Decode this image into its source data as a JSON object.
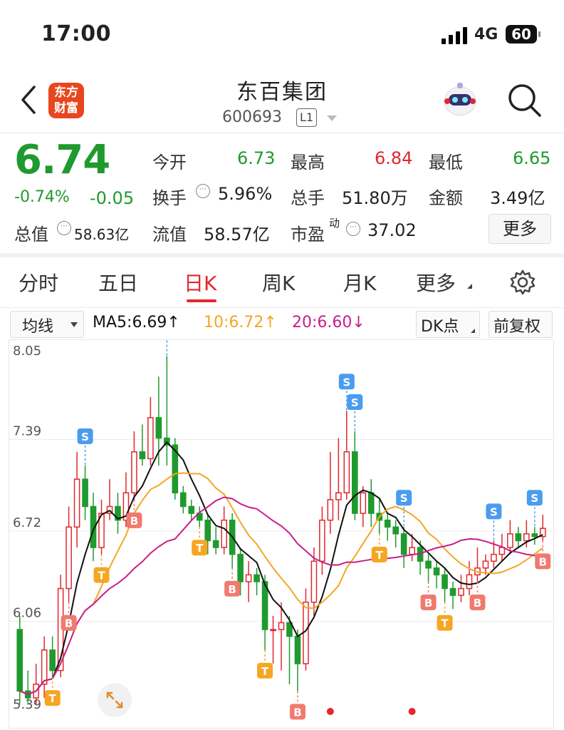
{
  "status_bar": {
    "time": "17:00",
    "network": "4G",
    "battery": "60"
  },
  "header": {
    "logo_text": "东方财富",
    "title": "东百集团",
    "code": "600693",
    "level": "L1"
  },
  "quote": {
    "price": "6.74",
    "change_pct": "-0.74%",
    "change": "-0.05",
    "open_label": "今开",
    "open": "6.73",
    "high_label": "最高",
    "high": "6.84",
    "low_label": "最低",
    "low": "6.65",
    "turnover_label": "换手",
    "turnover": "5.96%",
    "volume_label": "总手",
    "volume": "51.80万",
    "amount_label": "金额",
    "amount": "3.49亿",
    "mktcap_label": "总值",
    "mktcap": "58.63亿",
    "float_label": "流值",
    "float_cap": "58.57亿",
    "pe_label": "市盈",
    "pe_sup": "动",
    "pe": "37.02",
    "more_label": "更多"
  },
  "tabs": [
    {
      "label": "分时"
    },
    {
      "label": "五日"
    },
    {
      "label": "日K"
    },
    {
      "label": "周K"
    },
    {
      "label": "月K"
    },
    {
      "label": "更多"
    }
  ],
  "chart_controls": {
    "indicator": "均线",
    "ma5": "MA5:6.69↑",
    "ma10": "10:6.72↑",
    "ma20": "20:6.60↓",
    "dk": "DK点",
    "adjust": "前复权"
  },
  "colors": {
    "up": "#e0282e",
    "down": "#1f9a2e",
    "ma5": "#111111",
    "ma10": "#f5a623",
    "ma20": "#c81e8c",
    "accent": "#e0282e"
  },
  "chart_data": {
    "type": "candlestick",
    "y_axis_labels": [
      "8.05",
      "7.39",
      "6.72",
      "6.06",
      "5.39"
    ],
    "ylim": [
      5.39,
      8.05
    ],
    "markers": {
      "S": "S",
      "B": "B",
      "T": "T"
    },
    "candles": [
      [
        6.0,
        5.55,
        6.1,
        5.45
      ],
      [
        5.55,
        5.5,
        5.7,
        5.45
      ],
      [
        5.5,
        5.6,
        5.75,
        5.45
      ],
      [
        5.6,
        5.85,
        5.95,
        5.5
      ],
      [
        5.85,
        5.7,
        5.95,
        5.65
      ],
      [
        5.7,
        6.3,
        6.4,
        5.65
      ],
      [
        6.3,
        6.75,
        6.9,
        6.2
      ],
      [
        6.75,
        7.1,
        7.3,
        6.6
      ],
      [
        7.1,
        6.9,
        7.2,
        6.8
      ],
      [
        6.9,
        6.6,
        7.0,
        6.5
      ],
      [
        6.6,
        6.85,
        6.95,
        6.55
      ],
      [
        6.85,
        6.9,
        7.1,
        6.8
      ],
      [
        6.9,
        6.8,
        7.0,
        6.7
      ],
      [
        6.8,
        7.0,
        7.15,
        6.75
      ],
      [
        7.0,
        7.3,
        7.45,
        6.95
      ],
      [
        7.3,
        7.25,
        7.5,
        7.2
      ],
      [
        7.25,
        7.55,
        7.7,
        7.2
      ],
      [
        7.55,
        7.4,
        7.85,
        7.2
      ],
      [
        7.4,
        7.35,
        8.0,
        7.2
      ],
      [
        7.35,
        7.0,
        7.4,
        6.95
      ],
      [
        7.0,
        6.9,
        7.05,
        6.85
      ],
      [
        6.9,
        6.85,
        6.95,
        6.8
      ],
      [
        6.85,
        6.8,
        6.9,
        6.75
      ],
      [
        6.8,
        6.65,
        6.85,
        6.55
      ],
      [
        6.65,
        6.6,
        6.75,
        6.55
      ],
      [
        6.6,
        6.8,
        6.9,
        6.55
      ],
      [
        6.8,
        6.55,
        6.85,
        6.45
      ],
      [
        6.55,
        6.35,
        6.6,
        6.25
      ],
      [
        6.35,
        6.4,
        6.5,
        6.2
      ],
      [
        6.4,
        6.35,
        6.45,
        6.25
      ],
      [
        6.35,
        6.0,
        6.4,
        5.85
      ],
      [
        6.0,
        6.0,
        6.1,
        5.75
      ],
      [
        6.0,
        6.05,
        6.2,
        5.7
      ],
      [
        6.05,
        5.95,
        6.1,
        5.6
      ],
      [
        5.95,
        5.75,
        6.0,
        5.55
      ],
      [
        5.75,
        6.2,
        6.3,
        5.7
      ],
      [
        6.2,
        6.5,
        6.6,
        6.1
      ],
      [
        6.5,
        6.8,
        6.9,
        6.4
      ],
      [
        6.8,
        6.95,
        7.3,
        6.7
      ],
      [
        6.95,
        7.0,
        7.4,
        6.8
      ],
      [
        7.0,
        7.3,
        7.6,
        6.95
      ],
      [
        7.3,
        6.85,
        7.45,
        6.8
      ],
      [
        6.85,
        7.0,
        7.05,
        6.75
      ],
      [
        7.0,
        6.85,
        7.1,
        6.75
      ],
      [
        6.85,
        6.8,
        6.95,
        6.7
      ],
      [
        6.8,
        6.75,
        6.85,
        6.65
      ],
      [
        6.75,
        6.7,
        6.8,
        6.6
      ],
      [
        6.7,
        6.55,
        6.75,
        6.45
      ],
      [
        6.55,
        6.6,
        6.7,
        6.5
      ],
      [
        6.6,
        6.5,
        6.65,
        6.4
      ],
      [
        6.5,
        6.45,
        6.55,
        6.35
      ],
      [
        6.45,
        6.4,
        6.5,
        6.3
      ],
      [
        6.4,
        6.3,
        6.45,
        6.2
      ],
      [
        6.3,
        6.25,
        6.35,
        6.15
      ],
      [
        6.25,
        6.3,
        6.4,
        6.2
      ],
      [
        6.3,
        6.4,
        6.5,
        6.25
      ],
      [
        6.4,
        6.45,
        6.6,
        6.35
      ],
      [
        6.45,
        6.5,
        6.55,
        6.4
      ],
      [
        6.5,
        6.55,
        6.65,
        6.45
      ],
      [
        6.55,
        6.6,
        6.7,
        6.5
      ],
      [
        6.6,
        6.7,
        6.8,
        6.55
      ],
      [
        6.7,
        6.65,
        6.75,
        6.6
      ],
      [
        6.65,
        6.7,
        6.8,
        6.6
      ],
      [
        6.7,
        6.68,
        6.75,
        6.62
      ],
      [
        6.68,
        6.74,
        6.84,
        6.65
      ]
    ]
  }
}
